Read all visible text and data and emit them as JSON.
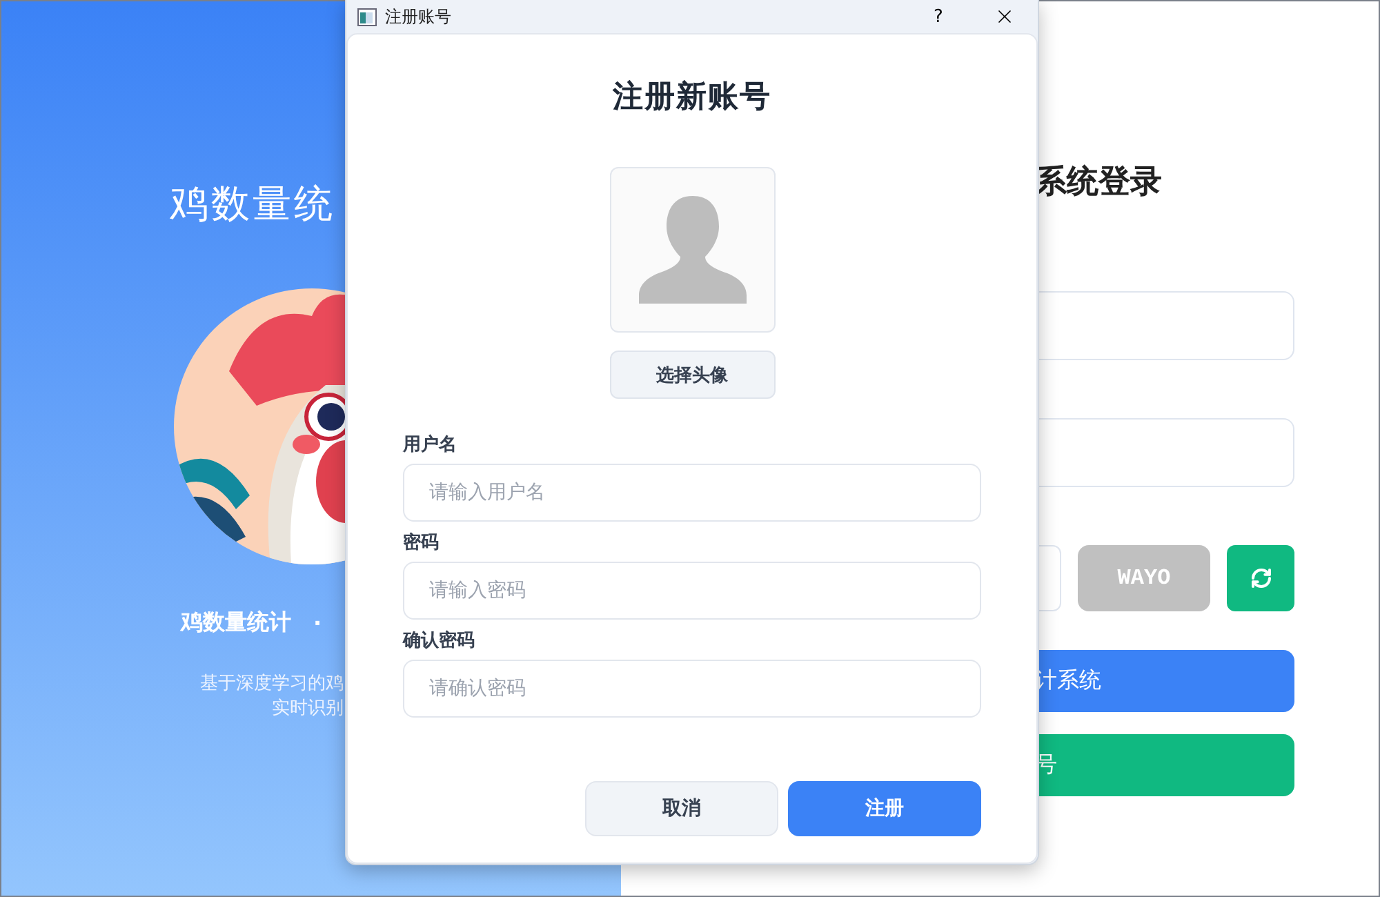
{
  "login_window": {
    "brand_panel": {
      "title": "鸡数量统",
      "picture": {
        "kind": "picture"
      },
      "tagline": "鸡数量统计",
      "separator": "·",
      "description_lines": [
        "基于深度学习的鸡",
        "实时识别"
      ]
    },
    "login_panel": {
      "title": "系统登录",
      "captcha": "WAYO",
      "buttons": [
        {
          "label": "计系统",
          "kind": "primary"
        },
        {
          "label": "号",
          "kind": "success"
        }
      ]
    }
  },
  "dialog": {
    "title": "注册账号",
    "help": "?",
    "heading": "注册新账号",
    "avatar_button": "选择头像",
    "fields": [
      {
        "label": "用户名",
        "placeholder": "请输入用户名"
      },
      {
        "label": "密码",
        "placeholder": "请输入密码"
      },
      {
        "label": "确认密码",
        "placeholder": "请确认密码"
      }
    ],
    "buttons": [
      {
        "label": "取消",
        "kind": "secondary"
      },
      {
        "label": "注册",
        "kind": "primary"
      }
    ]
  }
}
